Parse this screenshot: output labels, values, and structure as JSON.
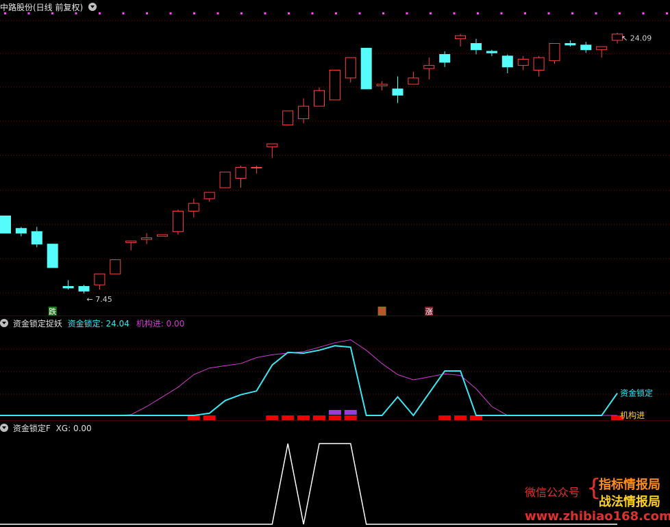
{
  "title": "中路股份(日线 前复权)",
  "colors": {
    "up": "#ff4040",
    "down": "#54fcfc",
    "magenta": "#ff44ff",
    "purple": "#9a3cd8",
    "red_bar": "#ee0000",
    "white": "#ffffff",
    "grid": "#8b0000"
  },
  "main": {
    "high_label": "24.09",
    "low_label": "7.45",
    "signals": [
      {
        "text": "跌",
        "bg": "#1f7a1f",
        "fg": "#ffffff",
        "candle": 3
      },
      {
        "text": "榜",
        "bg": "#8a6d2a",
        "fg": "#ff3333",
        "candle": 24
      },
      {
        "text": "涨",
        "bg": "#7a1f2a",
        "fg": "#ffffff",
        "candle": 27
      }
    ]
  },
  "chart_data": [
    {
      "type": "candlestick",
      "name": "中路股份(日线 前复权)",
      "ylim": [
        6.0,
        25.3
      ],
      "candles": [
        {
          "o": 12.4,
          "h": 12.4,
          "l": 11.3,
          "c": 11.3
        },
        {
          "o": 11.6,
          "h": 11.7,
          "l": 11.1,
          "c": 11.3
        },
        {
          "o": 11.4,
          "h": 11.7,
          "l": 10.4,
          "c": 10.6
        },
        {
          "o": 10.6,
          "h": 10.6,
          "l": 9.1,
          "c": 9.1
        },
        {
          "o": 7.9,
          "h": 8.3,
          "l": 7.7,
          "c": 7.8
        },
        {
          "o": 7.9,
          "h": 8.0,
          "l": 7.45,
          "c": 7.6
        },
        {
          "o": 8.0,
          "h": 8.7,
          "l": 7.7,
          "c": 8.7
        },
        {
          "o": 8.7,
          "h": 9.6,
          "l": 8.7,
          "c": 9.6
        },
        {
          "o": 10.7,
          "h": 10.8,
          "l": 10.2,
          "c": 10.8
        },
        {
          "o": 10.9,
          "h": 11.3,
          "l": 10.6,
          "c": 11.0
        },
        {
          "o": 11.1,
          "h": 11.2,
          "l": 11.1,
          "c": 11.2
        },
        {
          "o": 11.4,
          "h": 12.8,
          "l": 11.2,
          "c": 12.7
        },
        {
          "o": 12.7,
          "h": 13.5,
          "l": 12.3,
          "c": 13.2
        },
        {
          "o": 13.5,
          "h": 13.9,
          "l": 13.3,
          "c": 13.9
        },
        {
          "o": 14.2,
          "h": 15.2,
          "l": 14.2,
          "c": 15.2
        },
        {
          "o": 14.8,
          "h": 15.6,
          "l": 14.2,
          "c": 15.5
        },
        {
          "o": 15.5,
          "h": 15.6,
          "l": 15.1,
          "c": 15.5
        },
        {
          "o": 16.8,
          "h": 17.0,
          "l": 16.1,
          "c": 17.0
        },
        {
          "o": 18.2,
          "h": 19.1,
          "l": 18.2,
          "c": 19.1
        },
        {
          "o": 18.6,
          "h": 19.9,
          "l": 18.3,
          "c": 19.4
        },
        {
          "o": 19.4,
          "h": 20.6,
          "l": 19.4,
          "c": 20.4
        },
        {
          "o": 19.8,
          "h": 21.7,
          "l": 19.8,
          "c": 21.7
        },
        {
          "o": 21.2,
          "h": 21.9,
          "l": 20.9,
          "c": 22.5
        },
        {
          "o": 23.1,
          "h": 23.1,
          "l": 20.5,
          "c": 20.5
        },
        {
          "o": 20.7,
          "h": 21.0,
          "l": 20.4,
          "c": 20.8
        },
        {
          "o": 20.5,
          "h": 21.3,
          "l": 19.6,
          "c": 20.1
        },
        {
          "o": 20.8,
          "h": 21.6,
          "l": 20.8,
          "c": 21.2
        },
        {
          "o": 21.8,
          "h": 22.5,
          "l": 21.1,
          "c": 22.0
        },
        {
          "o": 22.7,
          "h": 22.9,
          "l": 21.9,
          "c": 22.2
        },
        {
          "o": 23.7,
          "h": 24.0,
          "l": 23.2,
          "c": 23.9
        },
        {
          "o": 23.4,
          "h": 23.7,
          "l": 22.7,
          "c": 23.0
        },
        {
          "o": 22.9,
          "h": 23.0,
          "l": 22.6,
          "c": 22.8
        },
        {
          "o": 22.6,
          "h": 22.7,
          "l": 21.5,
          "c": 21.9
        },
        {
          "o": 22.0,
          "h": 22.6,
          "l": 21.7,
          "c": 22.4
        },
        {
          "o": 21.7,
          "h": 22.6,
          "l": 21.3,
          "c": 22.5
        },
        {
          "o": 22.3,
          "h": 23.4,
          "l": 22.1,
          "c": 23.4
        },
        {
          "o": 23.4,
          "h": 23.6,
          "l": 23.2,
          "c": 23.3
        },
        {
          "o": 23.3,
          "h": 23.5,
          "l": 22.8,
          "c": 23.0
        },
        {
          "o": 23.0,
          "h": 23.2,
          "l": 22.5,
          "c": 23.2
        },
        {
          "o": 23.6,
          "h": 24.09,
          "l": 23.4,
          "c": 24.0
        }
      ]
    },
    {
      "type": "line",
      "name": "资金锁定捉妖",
      "ylim": [
        0,
        120
      ],
      "series": [
        {
          "name": "资金锁定",
          "value_label": "24.04",
          "color": "#38e8f5",
          "values": [
            0,
            0,
            0,
            0,
            0,
            0,
            0,
            0,
            0,
            0,
            0,
            0,
            0,
            3,
            20,
            28,
            33,
            68,
            85,
            84,
            88,
            94,
            92,
            0,
            0,
            25,
            0,
            30,
            60,
            60,
            0,
            0,
            0,
            0,
            0,
            0,
            0,
            0,
            0,
            30
          ]
        },
        {
          "name": "机构进",
          "value_label": "0.00",
          "color": "#d33bd3",
          "values": [
            0,
            0,
            0,
            0,
            0,
            0,
            0,
            0,
            1,
            12,
            25,
            38,
            55,
            64,
            67,
            70,
            78,
            82,
            84,
            86,
            92,
            98,
            102,
            88,
            70,
            55,
            48,
            52,
            56,
            54,
            36,
            12,
            0,
            0,
            0,
            0,
            0,
            0,
            0,
            0
          ]
        }
      ],
      "red_bars": [
        12,
        13,
        17,
        18,
        19,
        20,
        21,
        22,
        28,
        29,
        30,
        39
      ],
      "purple_bars": [
        21,
        22
      ]
    },
    {
      "type": "line",
      "name": "资金锁定F",
      "ylim": [
        0,
        1.12
      ],
      "series": [
        {
          "name": "XG",
          "value_label": "0.00",
          "color": "#ffffff",
          "values": [
            0,
            0,
            0,
            0,
            0,
            0,
            0,
            0,
            0,
            0,
            0,
            0,
            0,
            0,
            0,
            0,
            0,
            0,
            1,
            0,
            1,
            1,
            1,
            0,
            0,
            0,
            0,
            0,
            0,
            0,
            0,
            0,
            0,
            0,
            0,
            0,
            0,
            0,
            0,
            0
          ]
        }
      ]
    }
  ],
  "watermark": {
    "label": "微信公众号",
    "line1": "指标情报局",
    "line2": "战法情报局",
    "url": "www.zhibiao168.com"
  }
}
